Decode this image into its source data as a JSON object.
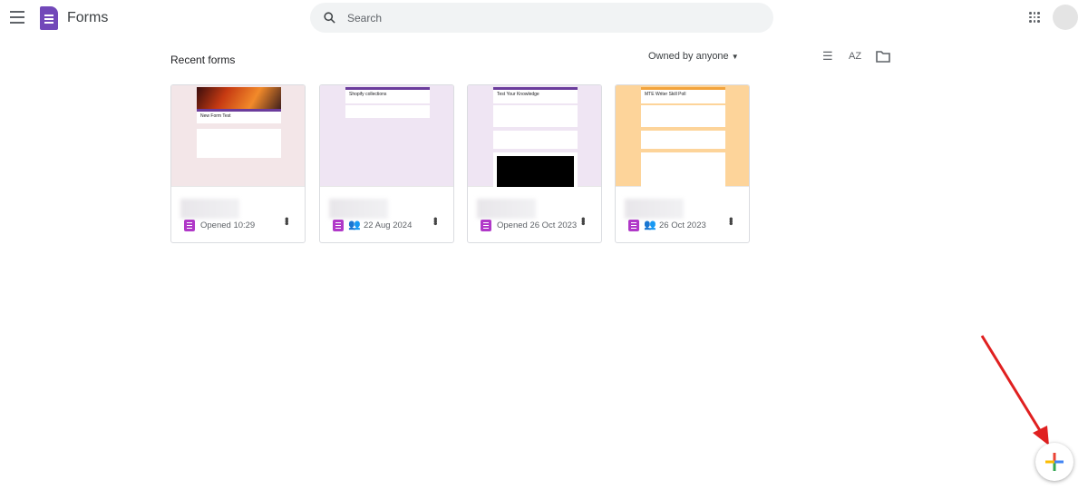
{
  "header": {
    "app_title": "Forms",
    "search_placeholder": "Search"
  },
  "toolbar": {
    "section_title": "Recent forms",
    "owner_filter": "Owned by anyone",
    "icons": [
      "list-view-icon",
      "sort-az-icon",
      "folder-icon"
    ]
  },
  "cards": [
    {
      "thumb_title": "New Form Test",
      "meta": "Opened 10:29",
      "shared": false,
      "bg": "#f3e6e8"
    },
    {
      "thumb_title": "Shopify collections",
      "meta": "22 Aug 2024",
      "shared": true,
      "bg": "#efe5f3"
    },
    {
      "thumb_title": "Test Your Knowledge",
      "meta": "Opened 26 Oct 2023",
      "shared": false,
      "bg": "#efe5f3"
    },
    {
      "thumb_title": "MTE Writer Skill Poll",
      "meta": "26 Oct 2023",
      "shared": true,
      "bg": "#fdd49a"
    }
  ],
  "colors": {
    "forms_purple": "#7248b9",
    "annotation_arrow": "#e02020"
  }
}
